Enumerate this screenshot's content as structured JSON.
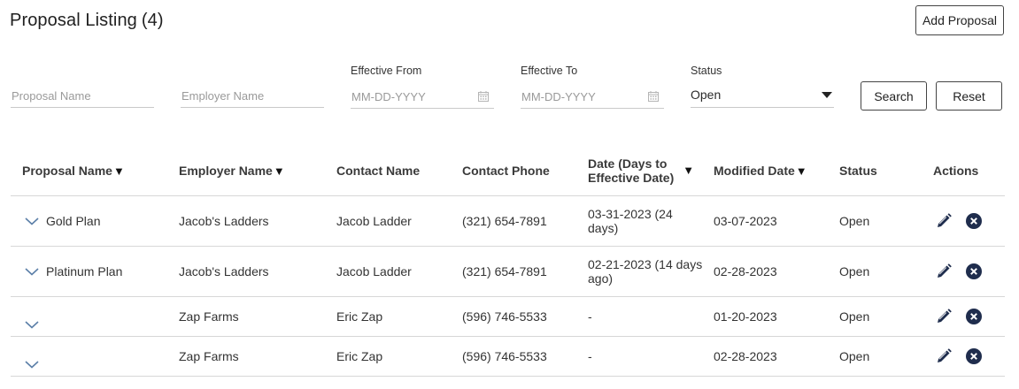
{
  "header": {
    "title": "Proposal Listing",
    "count": "(4)",
    "add_button": "Add Proposal"
  },
  "filters": {
    "proposal_name_placeholder": "Proposal Name",
    "employer_name_placeholder": "Employer Name",
    "effective_from_label": "Effective From",
    "effective_from_placeholder": "MM-DD-YYYY",
    "effective_to_label": "Effective To",
    "effective_to_placeholder": "MM-DD-YYYY",
    "status_label": "Status",
    "status_value": "Open",
    "search_button": "Search",
    "reset_button": "Reset"
  },
  "table": {
    "columns": {
      "proposal_name": "Proposal Name",
      "employer_name": "Employer Name",
      "contact_name": "Contact Name",
      "contact_phone": "Contact Phone",
      "date_line1": "Date (Days to",
      "date_line2": "Effective Date)",
      "modified_date": "Modified Date",
      "status": "Status",
      "actions": "Actions"
    },
    "sort_glyph": "▼",
    "rows": [
      {
        "proposal": "Gold Plan",
        "employer": "Jacob's Ladders",
        "contact": "Jacob Ladder",
        "phone": "(321) 654-7891",
        "date": "03-31-2023 (24 days)",
        "modified": "03-07-2023",
        "status": "Open"
      },
      {
        "proposal": "Platinum Plan",
        "employer": "Jacob's Ladders",
        "contact": "Jacob Ladder",
        "phone": "(321) 654-7891",
        "date": "02-21-2023 (14 days ago)",
        "modified": "02-28-2023",
        "status": "Open"
      },
      {
        "proposal": "",
        "employer": "Zap Farms",
        "contact": "Eric Zap",
        "phone": "(596) 746-5533",
        "date": "-",
        "modified": "01-20-2023",
        "status": "Open"
      },
      {
        "proposal": "",
        "employer": "Zap Farms",
        "contact": "Eric Zap",
        "phone": "(596) 746-5533",
        "date": "-",
        "modified": "02-28-2023",
        "status": "Open"
      }
    ]
  },
  "colors": {
    "icon": "#1f2d4d",
    "chevron": "#5b7fa8",
    "border": "#d7d7d7"
  },
  "icons": {
    "row_expand": "chevron-down-icon",
    "edit": "pencil-icon",
    "delete": "close-circle-icon",
    "calendar": "calendar-icon",
    "dropdown": "caret-down-icon"
  }
}
